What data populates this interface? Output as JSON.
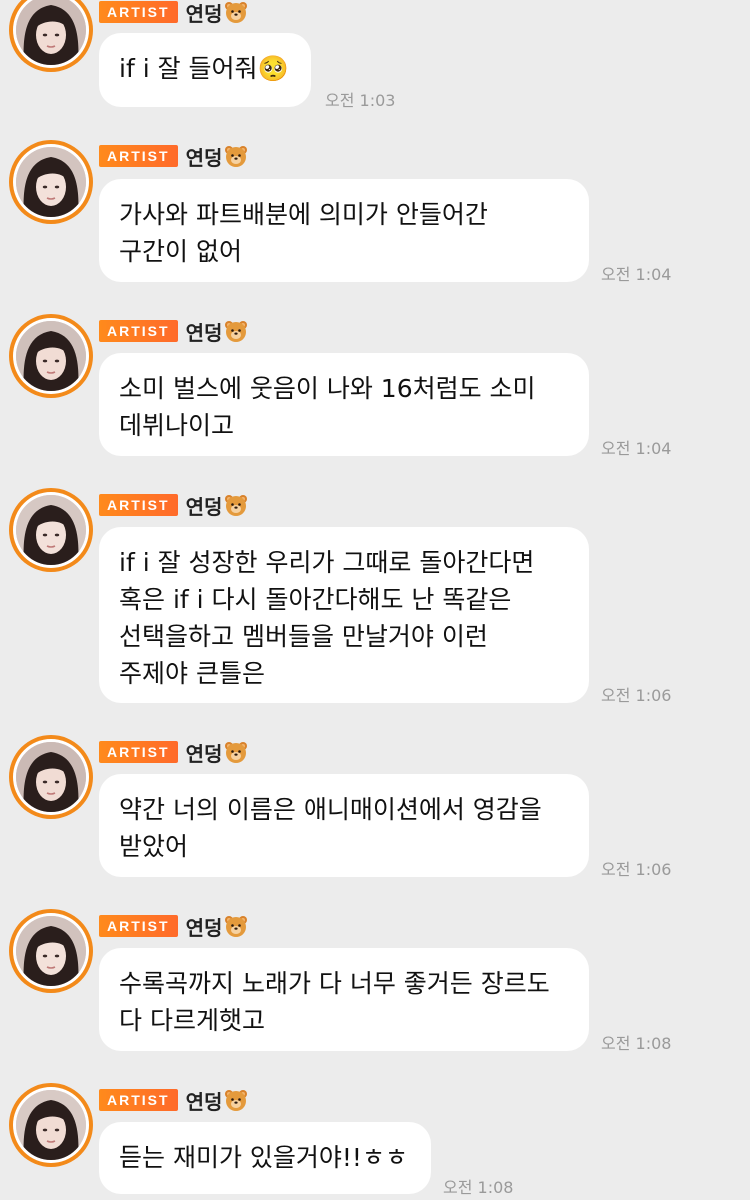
{
  "messages": [
    {
      "badge": "ARTIST",
      "sender": "연덩",
      "lines": [
        "if i 잘 들어줘🥺"
      ],
      "time": "오전 1:03"
    },
    {
      "badge": "ARTIST",
      "sender": "연덩",
      "lines": [
        "가사와 파트배분에 의미가 안들어간",
        "구간이 없어"
      ],
      "time": "오전 1:04"
    },
    {
      "badge": "ARTIST",
      "sender": "연덩",
      "lines": [
        "소미 벌스에 웃음이 나와 16처럼도 소미",
        "데뷔나이고"
      ],
      "time": "오전 1:04"
    },
    {
      "badge": "ARTIST",
      "sender": "연덩",
      "lines": [
        "if i 잘 성장한 우리가 그때로 돌아간다면",
        "혹은 if i 다시 돌아간다해도 난 똑같은",
        "선택을하고 멤버들을 만날거야 이런",
        "주제야 큰틀은"
      ],
      "time": "오전 1:06"
    },
    {
      "badge": "ARTIST",
      "sender": "연덩",
      "lines": [
        "약간 너의 이름은 애니매이션에서 영감을",
        "받았어"
      ],
      "time": "오전 1:06"
    },
    {
      "badge": "ARTIST",
      "sender": "연덩",
      "lines": [
        "수록곡까지 노래가 다 너무 좋거든 장르도",
        "다 다르게햇고"
      ],
      "time": "오전 1:08"
    },
    {
      "badge": "ARTIST",
      "sender": "연덩",
      "lines": [
        "듣는 재미가 있을거야!!ㅎㅎ"
      ],
      "time": "오전 1:08"
    }
  ],
  "icons": {
    "sender_emoji": "bear-face-icon",
    "avatar": "profile-photo"
  },
  "colors": {
    "background": "#ececec",
    "bubble": "#ffffff",
    "badge": "#ff7a22",
    "avatar_ring": "#f38a1a",
    "timestamp": "#9a9a9a"
  }
}
